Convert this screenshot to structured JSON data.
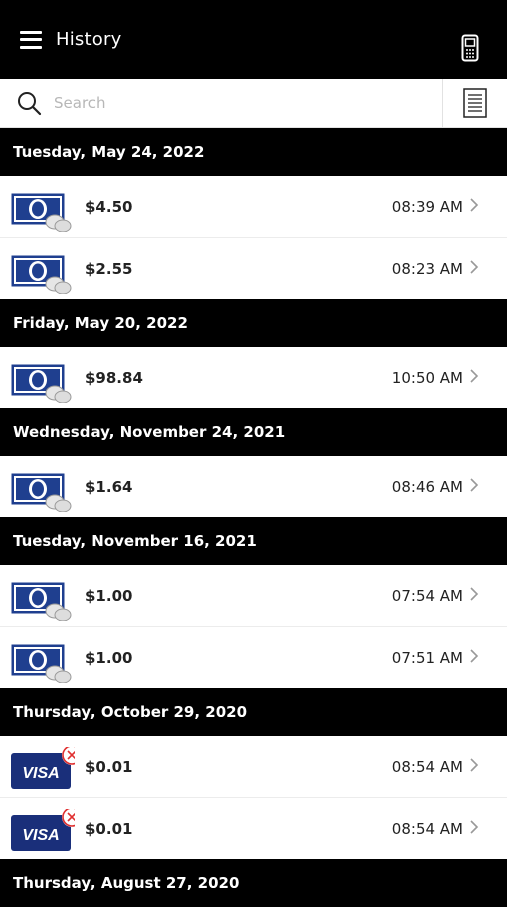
{
  "header": {
    "title": "History"
  },
  "search": {
    "placeholder": "Search"
  },
  "colors": {
    "header_bg": "#000000",
    "card_blue": "#1f3f8f",
    "visa_blue": "#1a2f7a",
    "error_red": "#e03030"
  },
  "sections": [
    {
      "date": "Tuesday, May 24, 2022",
      "items": [
        {
          "type": "cash",
          "amount": "$4.50",
          "time": "08:39 AM"
        },
        {
          "type": "cash",
          "amount": "$2.55",
          "time": "08:23 AM"
        }
      ]
    },
    {
      "date": "Friday, May 20, 2022",
      "items": [
        {
          "type": "cash",
          "amount": "$98.84",
          "time": "10:50 AM"
        }
      ]
    },
    {
      "date": "Wednesday, November 24, 2021",
      "items": [
        {
          "type": "cash",
          "amount": "$1.64",
          "time": "08:46 AM"
        }
      ]
    },
    {
      "date": "Tuesday, November 16, 2021",
      "items": [
        {
          "type": "cash",
          "amount": "$1.00",
          "time": "07:54 AM"
        },
        {
          "type": "cash",
          "amount": "$1.00",
          "time": "07:51 AM"
        }
      ]
    },
    {
      "date": "Thursday, October 29, 2020",
      "items": [
        {
          "type": "visa_failed",
          "amount": "$0.01",
          "time": "08:54 AM",
          "card_label": "VISA"
        },
        {
          "type": "visa_failed",
          "amount": "$0.01",
          "time": "08:54 AM",
          "card_label": "VISA"
        }
      ]
    },
    {
      "date": "Thursday, August 27, 2020",
      "items": []
    }
  ]
}
